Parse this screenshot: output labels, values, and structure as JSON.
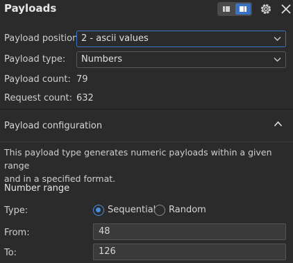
{
  "header": {
    "title": "Payloads"
  },
  "payload_position": {
    "label": "Payload position:",
    "value": "2 - ascii values"
  },
  "payload_type": {
    "label": "Payload type:",
    "value": "Numbers"
  },
  "payload_count": {
    "label": "Payload count:",
    "value": "79"
  },
  "request_count": {
    "label": "Request count:",
    "value": "632"
  },
  "configuration": {
    "title": "Payload configuration",
    "description_line1": "This payload type generates numeric payloads within a given range",
    "description_line2": "and in a specified format."
  },
  "number_range": {
    "heading": "Number range",
    "type_label": "Type:",
    "options": [
      "Sequential",
      "Random"
    ],
    "selected": "Sequential",
    "from_label": "From:",
    "from_value": "48",
    "to_label": "To:",
    "to_value": "126"
  },
  "colors": {
    "accent": "#3a72c4",
    "background": "#2b2b2b"
  }
}
